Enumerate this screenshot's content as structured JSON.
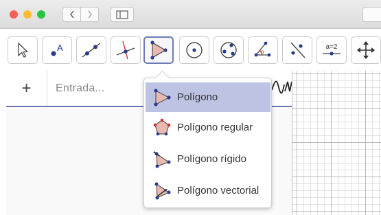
{
  "window": {
    "traffic_lights": [
      "#fd5c55",
      "#fdbb2e",
      "#2ac53f"
    ],
    "nav": {
      "back_icon": "chevron-left-icon",
      "forward_icon": "chevron-right-icon",
      "sidebar_icon": "sidebar-icon"
    }
  },
  "toolbar": {
    "tools": [
      {
        "name": "move-tool",
        "icon": "arrow-cursor-icon"
      },
      {
        "name": "point-tool",
        "icon": "point-icon"
      },
      {
        "name": "line-tool",
        "icon": "line-icon"
      },
      {
        "name": "perpendicular-line-tool",
        "icon": "perpendicular-icon"
      },
      {
        "name": "polygon-tool",
        "icon": "polygon-icon",
        "active": true
      },
      {
        "name": "circle-center-point-tool",
        "icon": "circle-icon"
      },
      {
        "name": "circle-three-points-tool",
        "icon": "circle-three-points-icon"
      },
      {
        "name": "angle-tool",
        "icon": "angle-icon"
      },
      {
        "name": "reflect-tool",
        "icon": "reflect-icon"
      },
      {
        "name": "slider-tool",
        "icon": "slider-icon",
        "text": "a=2"
      },
      {
        "name": "move-graphics-view-tool",
        "icon": "move-arrows-icon"
      }
    ],
    "active_color": "#6d7bb4"
  },
  "algebra": {
    "add_label": "+",
    "input_placeholder": "Entrada..."
  },
  "dropdown": {
    "items": [
      {
        "label": "Polígono",
        "icon": "polygon-icon",
        "selected": true
      },
      {
        "label": "Polígono regular",
        "icon": "regular-polygon-icon"
      },
      {
        "label": "Polígono rígido",
        "icon": "rigid-polygon-icon"
      },
      {
        "label": "Polígono vectorial",
        "icon": "vector-polygon-icon"
      }
    ],
    "selected_color": "#bcc3e3"
  }
}
